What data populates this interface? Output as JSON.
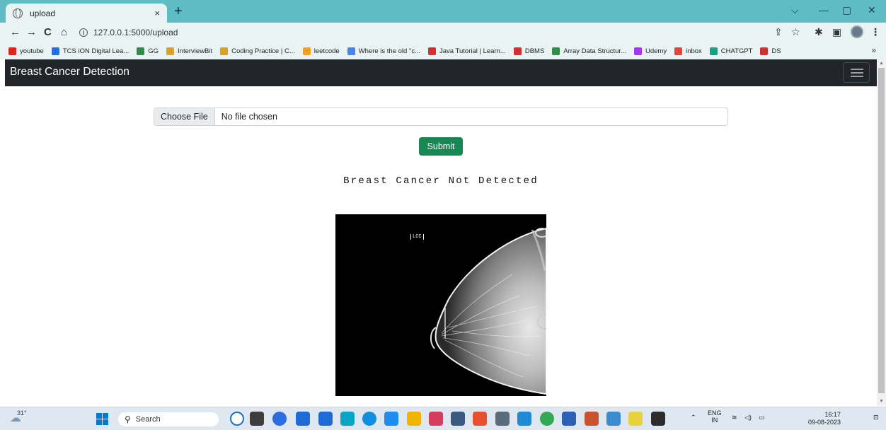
{
  "browser": {
    "tab_title": "upload",
    "tab_close": "×",
    "new_tab": "+",
    "url": "127.0.0.1:5000/upload",
    "window_controls": [
      "⌵",
      "—",
      "▢",
      "✕"
    ]
  },
  "bookmarks": [
    {
      "label": "youtube",
      "icon": "youtube-icon",
      "color": "#e62117"
    },
    {
      "label": "TCS iON Digital Lea...",
      "icon": "tcs-icon",
      "color": "#1a73e8"
    },
    {
      "label": "GG",
      "icon": "geeksforgeeks-icon",
      "color": "#2f8d46"
    },
    {
      "label": "InterviewBit",
      "icon": "interviewbit-icon",
      "color": "#e0a020"
    },
    {
      "label": "Coding Practice | C...",
      "icon": "coding-icon",
      "color": "#e0a020"
    },
    {
      "label": "leetcode",
      "icon": "leetcode-icon",
      "color": "#f89f1b"
    },
    {
      "label": "Where is the old \"c...",
      "icon": "google-icon",
      "color": "#4285f4"
    },
    {
      "label": "Java Tutorial | Learn...",
      "icon": "v-icon",
      "color": "#d32f2f"
    },
    {
      "label": "DBMS",
      "icon": "v-icon",
      "color": "#d32f2f"
    },
    {
      "label": "Array Data Structur...",
      "icon": "geeksforgeeks-icon",
      "color": "#2f8d46"
    },
    {
      "label": "Udemy",
      "icon": "udemy-icon",
      "color": "#a435f0"
    },
    {
      "label": "inbox",
      "icon": "gmail-icon",
      "color": "#ea4335"
    },
    {
      "label": "CHATGPT",
      "icon": "chatgpt-icon",
      "color": "#10a37f"
    },
    {
      "label": "DS",
      "icon": "v-icon",
      "color": "#d32f2f"
    }
  ],
  "bookmarks_more": "»",
  "app": {
    "brand": "Breast Cancer Detection",
    "choose_file_label": "Choose File",
    "file_status": "No file chosen",
    "submit_label": "Submit",
    "result_text": "Breast Cancer Not Detected",
    "image_tag": "LCC"
  },
  "taskbar": {
    "temperature": "31°",
    "search_label": "Search",
    "lang_top": "ENG",
    "lang_bottom": "IN",
    "time": "16:17",
    "date": "09-08-2023"
  },
  "colors": {
    "tab_strip": "#5fbcc5",
    "appbar": "#212529",
    "submit": "#198754"
  }
}
